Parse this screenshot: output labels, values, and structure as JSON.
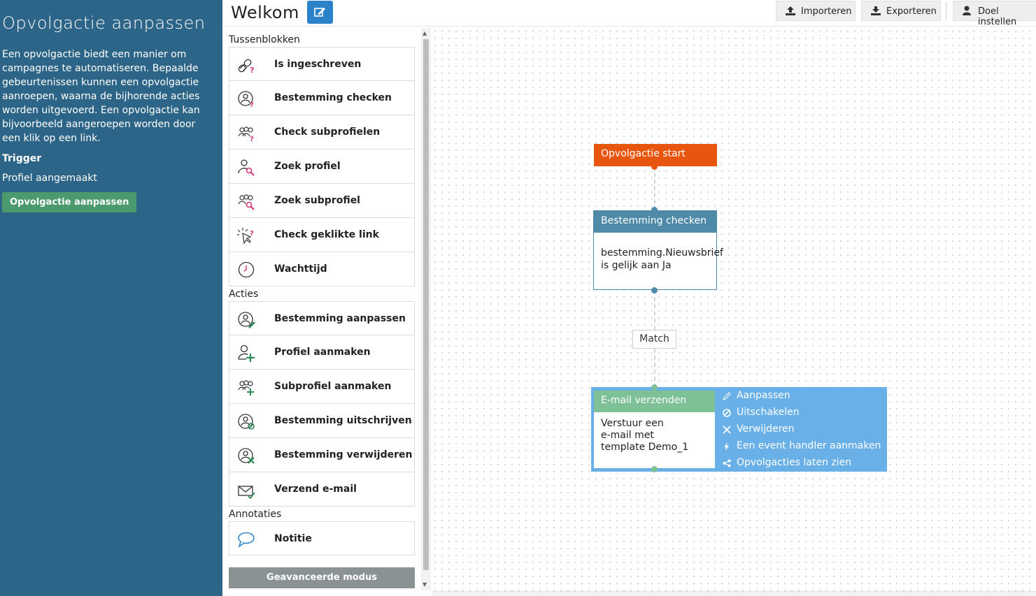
{
  "sidebar": {
    "title": "Opvolgactie aanpassen",
    "description": "Een opvolgactie biedt een manier om campagnes te automatiseren. Bepaalde gebeurtenissen kunnen een opvolgactie aanroepen, waarna de bijhorende acties worden uitgevoerd. Een opvolgactie kan bijvoorbeeld aangeroepen worden door een klik op een link.",
    "trigger_heading": "Trigger",
    "trigger_value": "Profiel aangemaakt",
    "edit_button": "Opvolgactie aanpassen"
  },
  "topbar": {
    "title": "Welkom",
    "import_label": "Importeren",
    "export_label": "Exporteren",
    "goal_label": "Doel instellen"
  },
  "palette": {
    "sections": [
      {
        "heading": "Tussenblokken",
        "items": [
          {
            "label": "Is ingeschreven",
            "icon": "link-question-icon"
          },
          {
            "label": "Bestemming checken",
            "icon": "target-question-icon"
          },
          {
            "label": "Check subprofielen",
            "icon": "group-question-icon"
          },
          {
            "label": "Zoek profiel",
            "icon": "user-search-icon"
          },
          {
            "label": "Zoek subprofiel",
            "icon": "group-search-icon"
          },
          {
            "label": "Check geklikte link",
            "icon": "click-question-icon"
          },
          {
            "label": "Wachttijd",
            "icon": "clock-icon"
          }
        ]
      },
      {
        "heading": "Acties",
        "items": [
          {
            "label": "Bestemming aanpassen",
            "icon": "target-edit-icon"
          },
          {
            "label": "Profiel aanmaken",
            "icon": "user-add-icon"
          },
          {
            "label": "Subprofiel aanmaken",
            "icon": "group-add-icon"
          },
          {
            "label": "Bestemming uitschrijven",
            "icon": "target-unsubscribe-icon"
          },
          {
            "label": "Bestemming verwijderen",
            "icon": "target-remove-icon"
          },
          {
            "label": "Verzend e-mail",
            "icon": "envelope-send-icon"
          }
        ]
      },
      {
        "heading": "Annotaties",
        "items": [
          {
            "label": "Notitie",
            "icon": "speech-bubble-icon"
          }
        ]
      }
    ],
    "advanced_button": "Geavanceerde modus"
  },
  "flow": {
    "start": {
      "label": "Opvolgactie start",
      "color": "#e8550e"
    },
    "check": {
      "title": "Bestemming checken",
      "line1": "bestemming.Nieuwsbrief",
      "line2": "is gelijk aan Ja",
      "color": "#4f8aa8"
    },
    "match": {
      "label": "Match"
    },
    "email": {
      "title": "E-mail verzenden",
      "line1": "Verstuur een",
      "line2": "e-mail met",
      "line3": "template Demo_1",
      "header_color": "#7fc197",
      "menu_color": "#69b0e8",
      "menu": [
        {
          "label": "Aanpassen",
          "icon": "pencil-icon"
        },
        {
          "label": "Uitschakelen",
          "icon": "disable-icon"
        },
        {
          "label": "Verwijderen",
          "icon": "close-icon"
        },
        {
          "label": "Een event handler aanmaken",
          "icon": "bolt-icon"
        },
        {
          "label": "Opvolgacties laten zien",
          "icon": "branch-icon"
        }
      ]
    }
  }
}
